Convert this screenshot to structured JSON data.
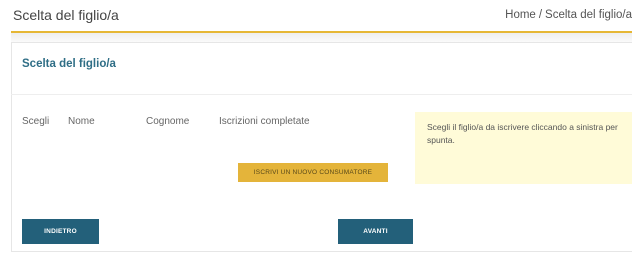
{
  "header": {
    "page_title": "Scelta del figlio/a",
    "breadcrumb": [
      "Home",
      "Scelta del figlio/a"
    ],
    "breadcrumb_separator": "/"
  },
  "card": {
    "title": "Scelta del figlio/a",
    "columns": [
      "Scegli",
      "Nome",
      "Cognome",
      "Iscrizioni completate"
    ],
    "hint": "Scegli il figlio/a da iscrivere cliccando a sinistra per spunta.",
    "add_button": "ISCRIVI UN NUOVO CONSUMATORE"
  },
  "footer": {
    "back_button": "INDIETRO",
    "next_button": "AVANTI"
  },
  "colors": {
    "accent_gold": "#e6b735",
    "primary_blue": "#23607a",
    "title_blue": "#2f6e86",
    "hint_background": "#fffbd8"
  }
}
